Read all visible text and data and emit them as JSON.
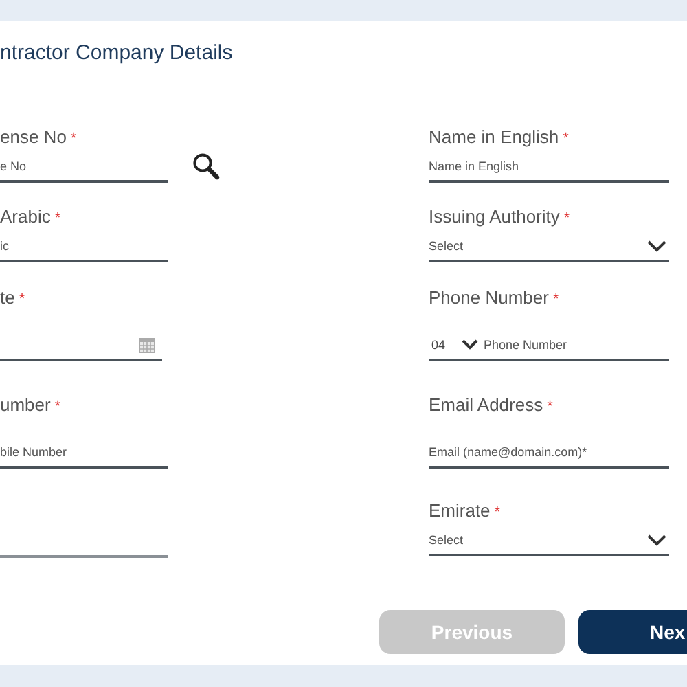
{
  "title": "ntractor Company Details",
  "left_fields": [
    {
      "kind": "search",
      "label": "ense No",
      "required_mark": "*",
      "placeholder": "e No"
    },
    {
      "kind": "text",
      "label": "Arabic",
      "required_mark": "*",
      "placeholder": "ic"
    },
    {
      "kind": "date",
      "label": "te",
      "required_mark": "*"
    },
    {
      "kind": "text",
      "label": "umber",
      "required_mark": "*",
      "placeholder": "bile Number"
    },
    {
      "kind": "text"
    }
  ],
  "right_fields": [
    {
      "kind": "text",
      "label": "Name in English",
      "required_mark": "*",
      "placeholder": "Name in English"
    },
    {
      "kind": "select",
      "label": "Issuing Authority",
      "required_mark": "*",
      "placeholder": "Select"
    },
    {
      "kind": "phone",
      "label": "Phone Number",
      "required_mark": "*",
      "code": "04",
      "placeholder": "Phone Number"
    },
    {
      "kind": "text",
      "label": "Email Address",
      "required_mark": "*",
      "placeholder": "Email (name@domain.com)*"
    },
    {
      "kind": "select",
      "label": "Emirate",
      "required_mark": "*",
      "placeholder": "Select"
    }
  ],
  "buttons": [
    {
      "label": "Previous",
      "disabled": true
    },
    {
      "label": "Nex",
      "disabled": false
    }
  ]
}
